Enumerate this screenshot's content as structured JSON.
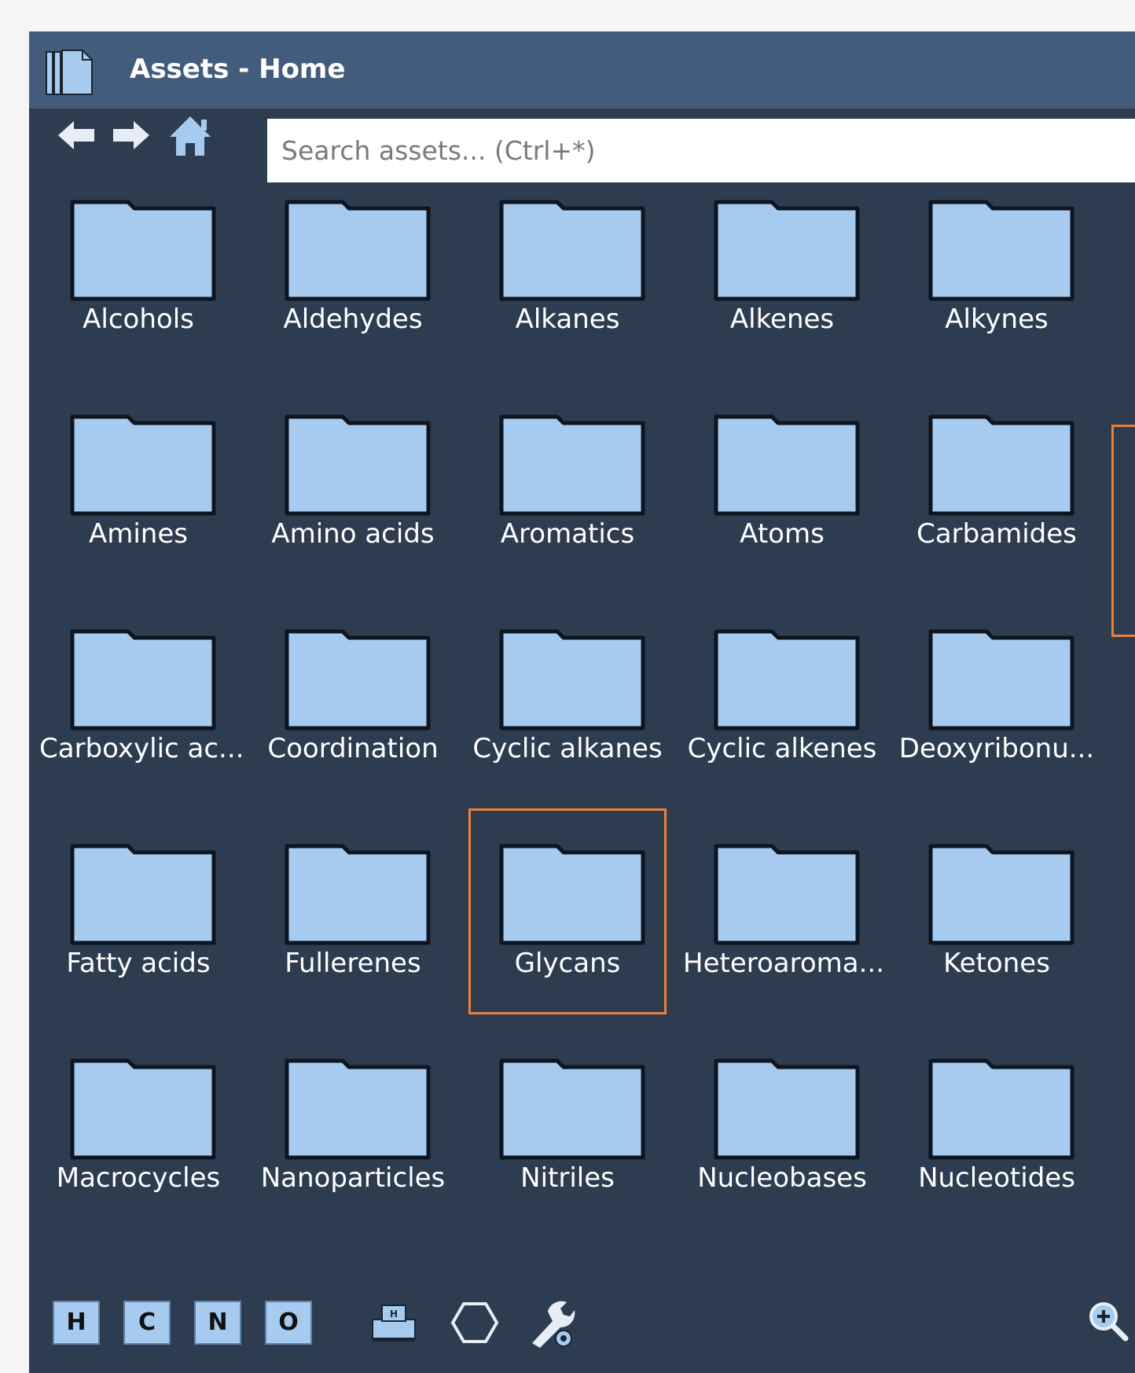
{
  "window": {
    "title": "Assets - Home"
  },
  "nav": {
    "back_icon": "arrow-left-icon",
    "forward_icon": "arrow-right-icon",
    "home_icon": "home-icon"
  },
  "search": {
    "placeholder": "Search assets... (Ctrl+*)",
    "value": ""
  },
  "folders": [
    {
      "label": "Alcohols"
    },
    {
      "label": "Aldehydes"
    },
    {
      "label": "Alkanes"
    },
    {
      "label": "Alkenes"
    },
    {
      "label": "Alkynes"
    },
    {
      "label": "Amines"
    },
    {
      "label": "Amino acids"
    },
    {
      "label": "Aromatics"
    },
    {
      "label": "Atoms"
    },
    {
      "label": "Carbamides"
    },
    {
      "label": "Carboxylic ac..."
    },
    {
      "label": "Coordination"
    },
    {
      "label": "Cyclic alkanes"
    },
    {
      "label": "Cyclic alkenes"
    },
    {
      "label": "Deoxyribonu..."
    },
    {
      "label": "Fatty acids"
    },
    {
      "label": "Fullerenes"
    },
    {
      "label": "Glycans",
      "selected": true
    },
    {
      "label": "Heteroaroma..."
    },
    {
      "label": "Ketones"
    },
    {
      "label": "Macrocycles"
    },
    {
      "label": "Nanoparticles"
    },
    {
      "label": "Nitriles"
    },
    {
      "label": "Nucleobases"
    },
    {
      "label": "Nucleotides"
    }
  ],
  "toolbar": {
    "elements": [
      "H",
      "C",
      "N",
      "O"
    ],
    "icons": [
      "builder-icon",
      "hexagon-ring-icon",
      "settings-wrench-icon",
      "zoom-in-icon"
    ]
  },
  "colors": {
    "window_bg": "#2e3c50",
    "titlebar_bg": "#445c7c",
    "folder_fill": "#a6cbef",
    "selection": "#e8823a"
  }
}
